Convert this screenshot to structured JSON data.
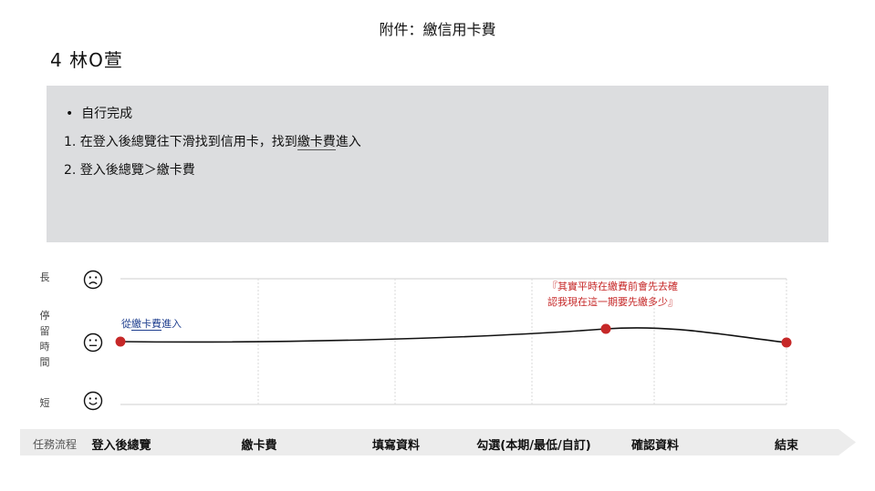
{
  "page": {
    "title": "附件：繳信用卡費",
    "person": "4 林O萱"
  },
  "notes": {
    "line1": "自行完成",
    "line2_prefix": "1.  在登入後總覽往下滑找到信用卡，找到",
    "line2_under": "繳卡費",
    "line2_suffix": "進入",
    "line3": "2.  登入後總覽＞繳卡費"
  },
  "y_axis": {
    "top": "長",
    "middle": [
      "停",
      "留",
      "時",
      "間"
    ],
    "bottom": "短"
  },
  "faces": {
    "top": "sad-face-icon",
    "middle": "neutral-face-icon",
    "bottom": "happy-face-icon"
  },
  "annotations": {
    "blue_prefix": "從",
    "blue_under": "繳卡費",
    "blue_suffix": "進入",
    "red": "『其實平時在繳費前會先去確認我現在這一期要先繳多少』"
  },
  "flow": {
    "title": "任務流程",
    "stages": [
      "登入後總覽",
      "繳卡費",
      "填寫資料",
      "勾選(本期/最低/自訂)",
      "確認資料",
      "結束"
    ]
  },
  "colors": {
    "point": "#c62828",
    "line": "#111111",
    "blue_text": "#1f3f8f",
    "red_text": "#c62828",
    "box": "#dcdddf",
    "flow_bar": "#ececec"
  },
  "chart_data": {
    "type": "line",
    "categories": [
      "登入後總覽",
      "繳卡費",
      "填寫資料",
      "勾選(本期/最低/自訂)",
      "確認資料",
      "結束"
    ],
    "ylim": [
      "短",
      "長"
    ],
    "points": [
      {
        "x": "登入後總覽",
        "y": "中"
      },
      {
        "x": "確認資料",
        "y": "中偏長"
      },
      {
        "x": "結束",
        "y": "中"
      }
    ]
  }
}
